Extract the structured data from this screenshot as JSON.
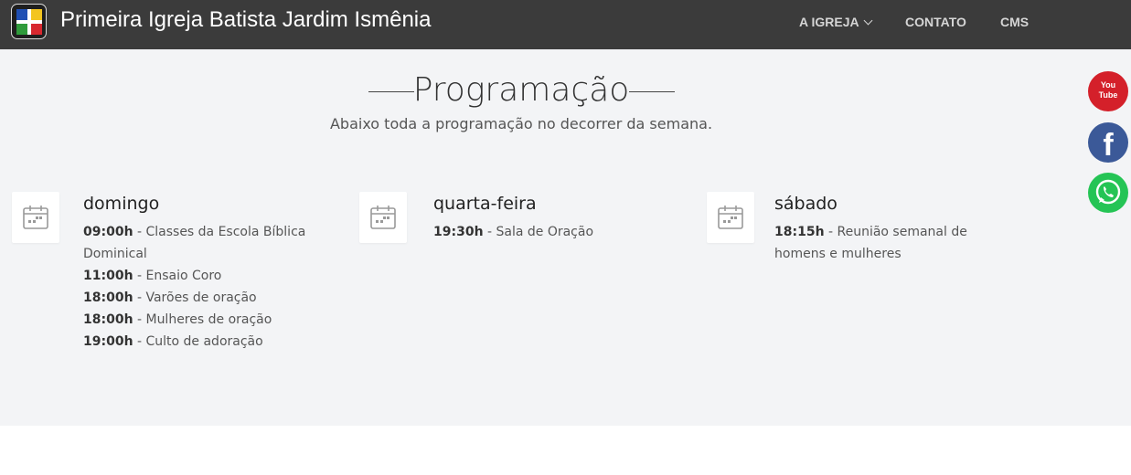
{
  "header": {
    "brand": "Primeira Igreja Batista Jardim Ismênia",
    "nav": [
      {
        "label": "A IGREJA"
      },
      {
        "label": "CONTATO"
      },
      {
        "label": "CMS"
      }
    ]
  },
  "section": {
    "title": "Programação",
    "subtitle": "Abaixo toda a programação no decorrer da semana.",
    "days": [
      {
        "name": "domingo",
        "items": [
          {
            "time": "09:00h",
            "desc": " - Classes da Escola Bíblica Dominical"
          },
          {
            "time": "11:00h",
            "desc": " - Ensaio Coro"
          },
          {
            "time": "18:00h",
            "desc": " - Varões de oração"
          },
          {
            "time": "18:00h",
            "desc": " - Mulheres de oração"
          },
          {
            "time": "19:00h",
            "desc": " - Culto de adoração"
          }
        ]
      },
      {
        "name": "quarta-feira",
        "items": [
          {
            "time": "19:30h",
            "desc": " - Sala de Oração"
          }
        ]
      },
      {
        "name": "sábado",
        "items": [
          {
            "time": "18:15h",
            "desc": " - Reunião semanal de homens e mulheres"
          }
        ]
      }
    ]
  },
  "social": {
    "youtube_top": "You",
    "youtube_bottom": "Tube",
    "facebook": "f"
  },
  "colors": {
    "navbar": "#3b3b3b",
    "section_bg": "#f3f4f6",
    "youtube": "#d4202a",
    "facebook": "#3b5998",
    "whatsapp": "#25c455"
  }
}
